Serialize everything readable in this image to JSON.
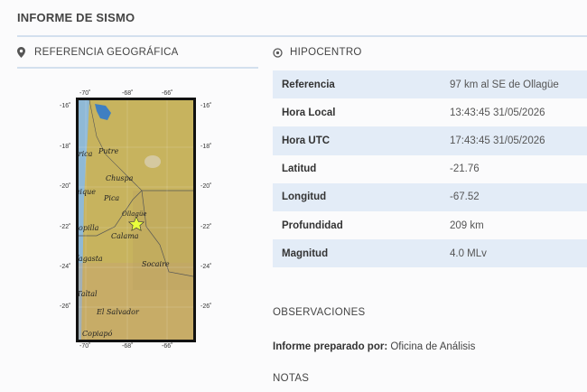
{
  "header": {
    "title": "INFORME DE SISMO"
  },
  "geo": {
    "title": "REFERENCIA GEOGRÁFICA",
    "map": {
      "lon_ticks": [
        "-70˚",
        "-68˚",
        "-66˚"
      ],
      "lat_ticks": [
        "-16˚",
        "-18˚",
        "-20˚",
        "-22˚",
        "-24˚",
        "-26˚"
      ],
      "places": [
        "Putre",
        "Arica",
        "Chuspa",
        "Iquique",
        "Pica",
        "Ollagüe",
        "Tocopilla",
        "Calama",
        "Antofagasta",
        "Socaire",
        "Taltal",
        "El Salvador",
        "Copiapó"
      ]
    }
  },
  "hypo": {
    "title": "HIPOCENTRO",
    "rows": [
      {
        "k": "Referencia",
        "v": "97 km al SE de Ollagüe"
      },
      {
        "k": "Hora Local",
        "v": "13:43:45 31/05/2026"
      },
      {
        "k": "Hora UTC",
        "v": "17:43:45 31/05/2026"
      },
      {
        "k": "Latitud",
        "v": "-21.76"
      },
      {
        "k": "Longitud",
        "v": "-67.52"
      },
      {
        "k": "Profundidad",
        "v": "209 km"
      },
      {
        "k": "Magnitud",
        "v": "4.0 MLv"
      }
    ]
  },
  "obs": {
    "title": "OBSERVACIONES",
    "prepared_label": "Informe preparado por:",
    "prepared_value": " Oficina de Análisis"
  },
  "notas": {
    "title": "NOTAS"
  }
}
